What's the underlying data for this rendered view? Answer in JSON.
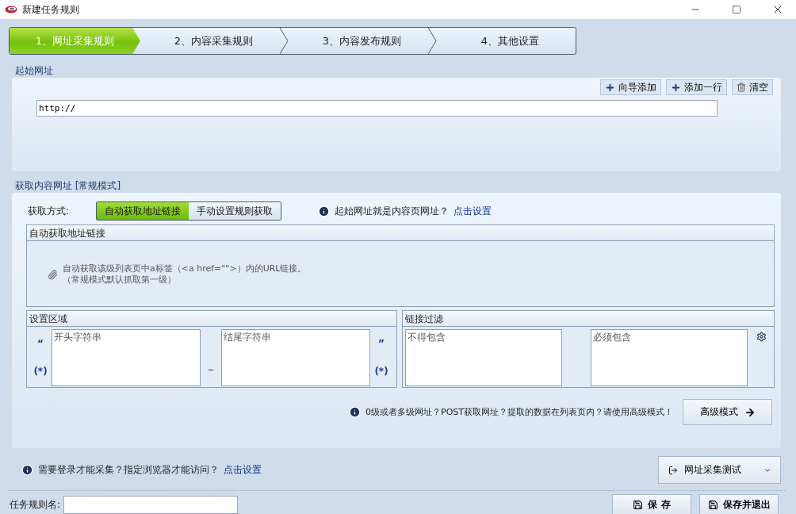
{
  "window": {
    "title": "新建任务规则"
  },
  "steps": [
    {
      "label": "1、网址采集规则",
      "selected": true
    },
    {
      "label": "2、内容采集规则",
      "selected": false
    },
    {
      "label": "3、内容发布规则",
      "selected": false
    },
    {
      "label": "4、其他设置",
      "selected": false
    }
  ],
  "start_url": {
    "label": "起始网址",
    "buttons": [
      {
        "label": "向导添加",
        "kind": "add"
      },
      {
        "label": "添加一行",
        "kind": "add"
      },
      {
        "label": "清空",
        "kind": "clear"
      }
    ],
    "value": "http://"
  },
  "content_url": {
    "label": "获取内容网址 [常规模式]",
    "method_label": "获取方式:",
    "methods": [
      {
        "label": "自动获取地址链接",
        "selected": true
      },
      {
        "label": "手动设置规则获取",
        "selected": false
      }
    ],
    "info": "起始网址就是内容页网址？",
    "info_link": "点击设置",
    "auto_panel": {
      "title": "自动获取地址链接",
      "lines": [
        "自动获取该级列表页中a标签（<a href=\"\">）内的URL链接。",
        "（常规模式默认抓取第一级）"
      ]
    },
    "region": {
      "title": "设置区域",
      "open_quote": "“",
      "close_quote": "”",
      "left_mark": "(*)",
      "right_mark": "(*)",
      "separator": "_",
      "start_placeholder": "开头字符串",
      "end_placeholder": "结尾字符串"
    },
    "filter": {
      "title": "链接过滤",
      "exclude_placeholder": "不得包含",
      "include_placeholder": "必须包含"
    },
    "advanced_info": "0级或者多级网址？POST获取网址？提取的数据在列表页内？请使用高级模式！",
    "advanced_button": "高级模式"
  },
  "footer": {
    "info": "需要登录才能采集？指定浏览器才能访问？",
    "link": "点击设置",
    "test_button": "网址采集测试",
    "name_label": "任务规则名:",
    "save": "保 存",
    "save_exit": "保存并退出"
  }
}
